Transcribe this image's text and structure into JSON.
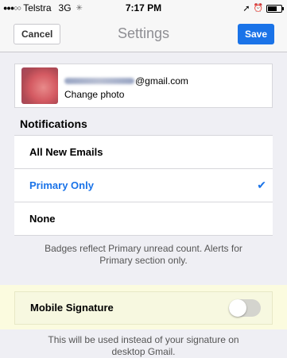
{
  "status_bar": {
    "carrier": "Telstra",
    "network": "3G",
    "time": "7:17 PM"
  },
  "nav": {
    "cancel_label": "Cancel",
    "title": "Settings",
    "save_label": "Save"
  },
  "account": {
    "email_domain": "@gmail.com",
    "change_photo": "Change photo"
  },
  "notifications": {
    "title": "Notifications",
    "options": [
      "All New Emails",
      "Primary Only",
      "None"
    ],
    "selected": "Primary Only",
    "note": "Badges reflect Primary unread count. Alerts for Primary section only."
  },
  "signature": {
    "label": "Mobile Signature",
    "enabled": false,
    "note": "This will be used instead of your signature on desktop Gmail."
  },
  "colors": {
    "accent": "#1a73e8",
    "background": "#efeff4",
    "signature_highlight": "#fbfbdf"
  }
}
